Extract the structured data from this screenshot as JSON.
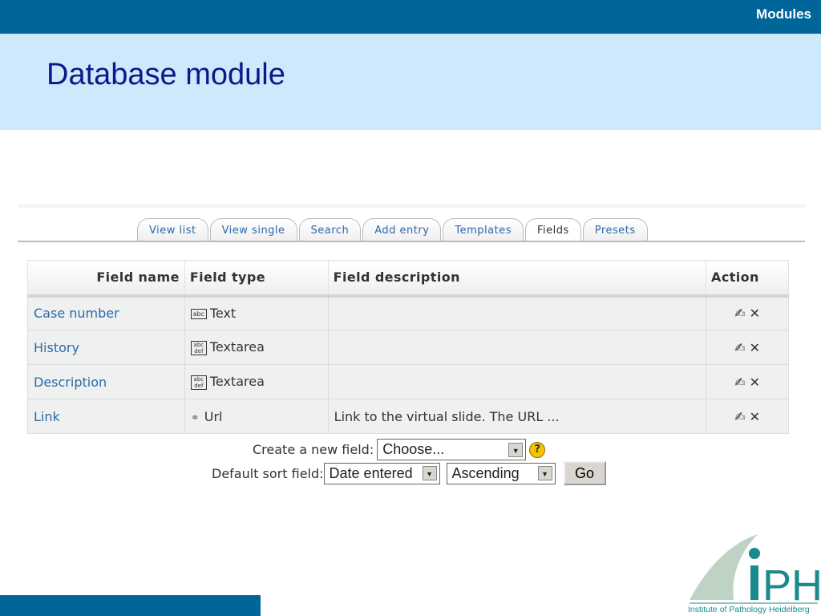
{
  "header": {
    "section": "Modules",
    "title": "Database module"
  },
  "tabs": [
    {
      "label": "View list"
    },
    {
      "label": "View single"
    },
    {
      "label": "Search"
    },
    {
      "label": "Add entry"
    },
    {
      "label": "Templates"
    },
    {
      "label": "Fields",
      "active": true
    },
    {
      "label": "Presets"
    }
  ],
  "table": {
    "headers": [
      "Field name",
      "Field type",
      "Field description",
      "Action"
    ],
    "rows": [
      {
        "name": "Case number",
        "type": "Text",
        "icon": "abc",
        "description": ""
      },
      {
        "name": "History",
        "type": "Textarea",
        "icon": "abc def",
        "description": ""
      },
      {
        "name": "Description",
        "type": "Textarea",
        "icon": "abc def",
        "description": ""
      },
      {
        "name": "Link",
        "type": "Url",
        "icon": "link",
        "description": "Link to the virtual slide. The URL ..."
      }
    ]
  },
  "form": {
    "create_label": "Create a new field:",
    "create_value": "Choose...",
    "sort_label": "Default sort field:",
    "sort_value": "Date entered",
    "order_value": "Ascending",
    "go": "Go"
  },
  "logo": {
    "text": "iPH",
    "subtitle": "Institute of Pathology Heidelberg"
  }
}
